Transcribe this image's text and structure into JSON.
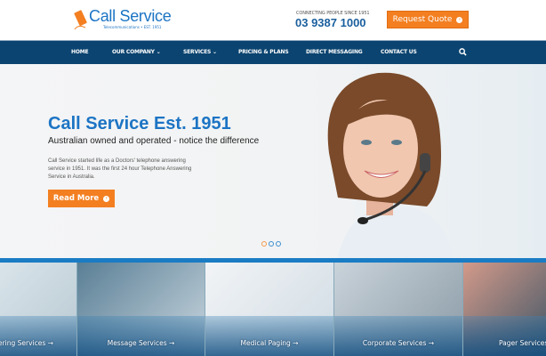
{
  "header": {
    "logo_text": "Call Service",
    "logo_subtitle": "Telecommunications • EST. 1951",
    "tagline": "CONNECTING PEOPLE SINCE 1951",
    "phone": "03 9387 1000",
    "quote_button": "Request Quote"
  },
  "nav": {
    "items": [
      {
        "label": "HOME"
      },
      {
        "label": "OUR COMPANY",
        "dropdown": true
      },
      {
        "label": "SERVICES",
        "dropdown": true
      },
      {
        "label": "PRICING & PLANS"
      },
      {
        "label": "DIRECT MESSAGING"
      },
      {
        "label": "CONTACT US"
      }
    ],
    "chevron": "⌄",
    "search_icon": "search-icon"
  },
  "hero": {
    "title": "Call Service Est. 1951",
    "subtitle": "Australian owned and operated - notice the difference",
    "body": "Call Service started life as a Doctors' telephone answering service in 1951. It was the first 24 hour Telephone Answering Service in Australia.",
    "button": "Read More",
    "slides": 3,
    "active_slide": 1
  },
  "tiles": [
    {
      "label": "Answering Services →"
    },
    {
      "label": "Message Services →"
    },
    {
      "label": "Medical Paging →"
    },
    {
      "label": "Corporate Services →"
    },
    {
      "label": "Pager Services →"
    }
  ],
  "colors": {
    "brand_blue": "#1c74c4",
    "nav_bg": "#0b4470",
    "accent_orange": "#f37f21"
  }
}
